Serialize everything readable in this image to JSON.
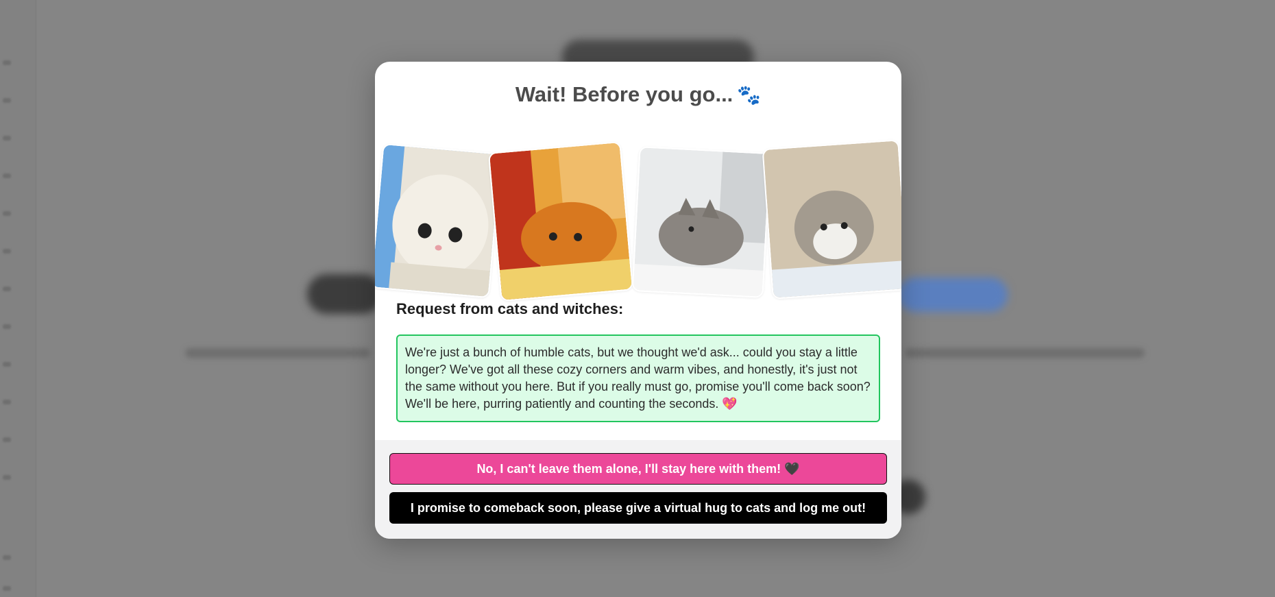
{
  "modal": {
    "title": "Wait! Before you go...",
    "title_icon": "🐾",
    "section_label": "Request from cats and witches:",
    "message": "We're just a bunch of humble cats, but we thought we'd ask... could you stay a little longer? We've got all these cozy corners and warm vibes, and honestly, it's just not the same without you here. But if you really must go, promise you'll come back soon? We'll be here, purring patiently and counting the seconds.",
    "message_emoji": "💖",
    "photos": [
      {
        "icon": "white-kitten-photo"
      },
      {
        "icon": "orange-kitten-photo"
      },
      {
        "icon": "gray-tabby-cat-photo"
      },
      {
        "icon": "tabby-kitten-photo"
      }
    ]
  },
  "actions": {
    "stay_label": "No, I can't leave them alone, I'll stay here with them!",
    "stay_emoji": "🖤",
    "logout_label": "I promise to comeback soon, please give a virtual hug to cats and log me out!"
  },
  "colors": {
    "stay_button": "#ec4899",
    "logout_button": "#000000",
    "message_bg": "#dcfce7",
    "message_border": "#22c55e",
    "overlay": "#858585"
  }
}
